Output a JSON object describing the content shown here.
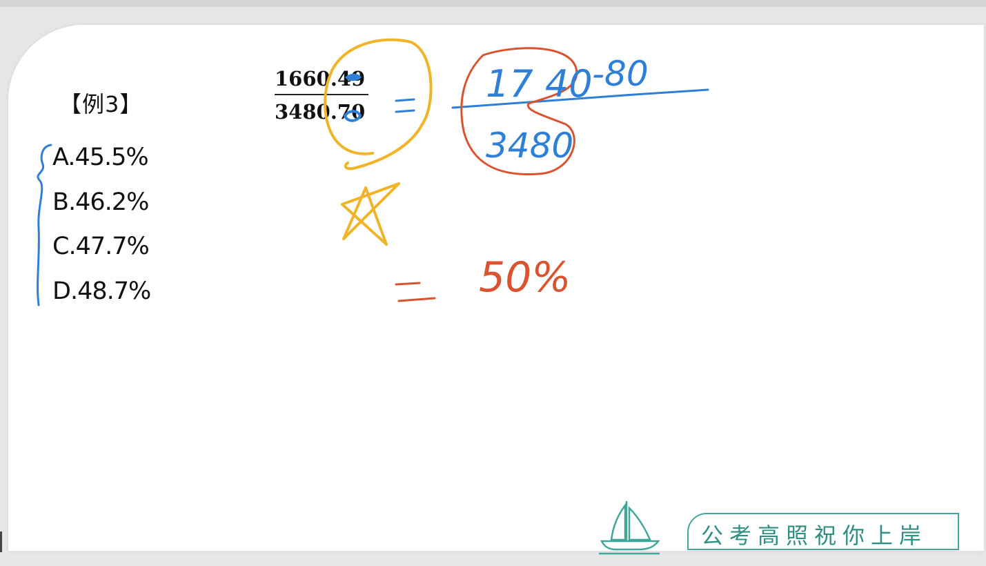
{
  "example": {
    "label": "【例3】"
  },
  "fraction": {
    "numerator": "1660.49",
    "denominator": "3480.70"
  },
  "options": [
    {
      "label": "A.45.5%"
    },
    {
      "label": "B.46.2%"
    },
    {
      "label": "C.47.7%"
    },
    {
      "label": "D.48.7%"
    }
  ],
  "handwriting": {
    "numerator": "17 40",
    "minus": "-80",
    "denominator": "3480",
    "result": "50%"
  },
  "branding": {
    "slogan": "公考高照祝你上岸",
    "icon": "sailboat-icon"
  },
  "colors": {
    "ink_yellow": "#f0b429",
    "ink_blue": "#2f7fd6",
    "ink_red": "#d9532f",
    "brand_teal": "#3ea79a"
  }
}
